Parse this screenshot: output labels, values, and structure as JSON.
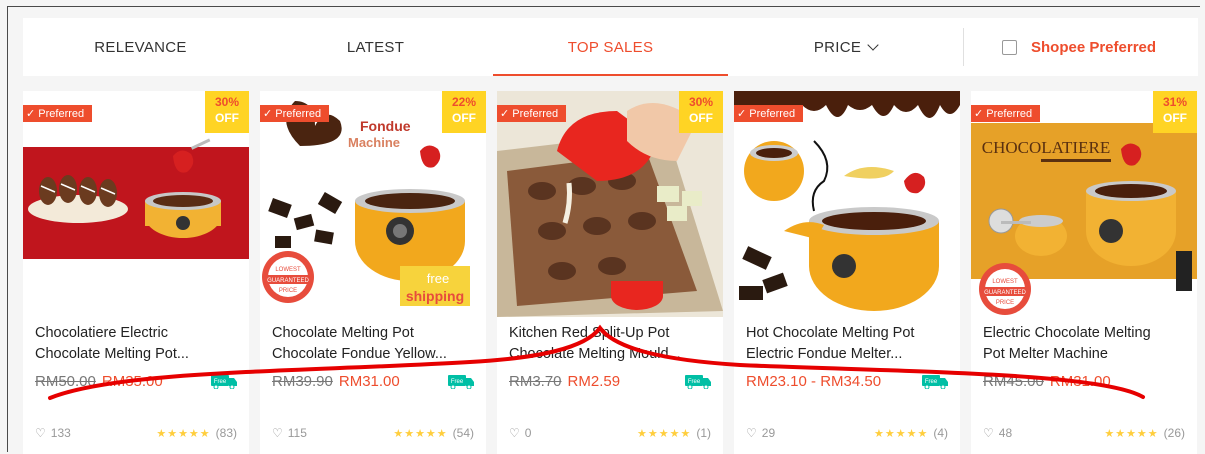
{
  "sortbar": {
    "tabs": [
      {
        "label": "RELEVANCE"
      },
      {
        "label": "LATEST"
      },
      {
        "label": "TOP SALES"
      },
      {
        "label": "PRICE"
      }
    ],
    "preferred_filter": "Shopee Preferred"
  },
  "colors": {
    "accent": "#ee4d2d",
    "discount_badge": "#ffd424",
    "star": "#ffce3d",
    "annotation": "#e60000"
  },
  "products": [
    {
      "badge": "Preferred",
      "discount": "30%",
      "discount_suffix": "OFF",
      "title_line1": "Chocolatiere Electric",
      "title_line2": "Chocolate Melting Pot...",
      "old_price": "RM50.00",
      "price": "RM35.00",
      "likes": "133",
      "stars": "★★★★★",
      "reviews": "(83)",
      "free_shipping": "Free"
    },
    {
      "badge": "Preferred",
      "discount": "22%",
      "discount_suffix": "OFF",
      "title_line1": "Chocolate Melting Pot",
      "title_line2": "Chocolate Fondue Yellow...",
      "old_price": "RM39.90",
      "price": "RM31.00",
      "likes": "115",
      "stars": "★★★★★",
      "reviews": "(54)",
      "free_shipping": "Free",
      "img_texts": {
        "a": "Fondue",
        "b": "Machine",
        "c": "free",
        "d": "shipping",
        "e": "LOWEST",
        "f": "GUARANTEED",
        "g": "PRICE"
      }
    },
    {
      "badge": "Preferred",
      "discount": "30%",
      "discount_suffix": "OFF",
      "title_line1": "Kitchen Red Split-Up Pot",
      "title_line2": "Chocolate Melting Mould...",
      "old_price": "RM3.70",
      "price": "RM2.59",
      "likes": "0",
      "stars": "★★★★★",
      "reviews": "(1)",
      "free_shipping": "Free"
    },
    {
      "badge": "Preferred",
      "discount": "",
      "discount_suffix": "",
      "title_line1": "Hot Chocolate Melting Pot",
      "title_line2": "Electric Fondue Melter...",
      "old_price": "",
      "price": "RM23.10 - RM34.50",
      "likes": "29",
      "stars": "★★★★★",
      "reviews": "(4)",
      "free_shipping": "Free"
    },
    {
      "badge": "Preferred",
      "discount": "31%",
      "discount_suffix": "OFF",
      "title_line1": "Electric Chocolate Melting",
      "title_line2": "Pot Melter Machine",
      "old_price": "RM45.00",
      "price": "RM31.00",
      "likes": "48",
      "stars": "★★★★★",
      "reviews": "(26)",
      "free_shipping": "",
      "img_texts": {
        "a": "CHOCOLATIERE",
        "e": "LOWEST",
        "f": "GUARANTEED",
        "g": "PRICE"
      }
    }
  ]
}
